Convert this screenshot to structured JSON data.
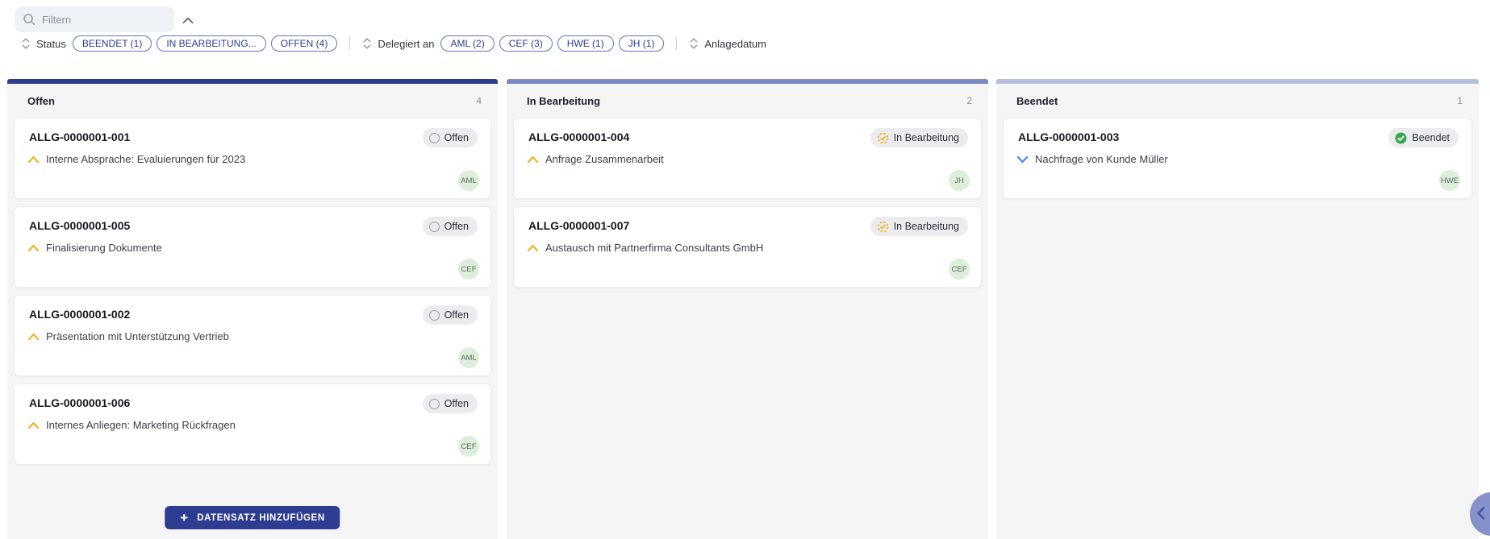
{
  "toolbar": {
    "search": {
      "placeholder": "Filtern"
    },
    "filters": [
      {
        "label": "Status",
        "pills": [
          "BEENDET (1)",
          "IN BEARBEITUNG...",
          "OFFEN (4)"
        ]
      },
      {
        "label": "Delegiert an",
        "pills": [
          "AML (2)",
          "CEF (3)",
          "HWE (1)",
          "JH (1)"
        ]
      },
      {
        "label": "Anlagedatum",
        "pills": []
      }
    ]
  },
  "board": {
    "columns": [
      {
        "title": "Offen",
        "count": "4",
        "accent": "#2e3c8c",
        "add_button": "DATENSATZ HINZUFÜGEN",
        "cards": [
          {
            "id": "ALLG-0000001-001",
            "description": "Interne Absprache: Evaluierungen für 2023",
            "status": "Offen",
            "status_type": "open",
            "priority": "up",
            "assignee": "AML"
          },
          {
            "id": "ALLG-0000001-005",
            "description": "Finalisierung Dokumente",
            "status": "Offen",
            "status_type": "open",
            "priority": "up",
            "assignee": "CEF"
          },
          {
            "id": "ALLG-0000001-002",
            "description": "Präsentation mit Unterstützung Vertrieb",
            "status": "Offen",
            "status_type": "open",
            "priority": "up",
            "assignee": "AML"
          },
          {
            "id": "ALLG-0000001-006",
            "description": "Internes Anliegen: Marketing Rückfragen",
            "status": "Offen",
            "status_type": "open",
            "priority": "up",
            "assignee": "CEF"
          }
        ]
      },
      {
        "title": "In Bearbeitung",
        "count": "2",
        "accent": "#7b89c2",
        "cards": [
          {
            "id": "ALLG-0000001-004",
            "description": "Anfrage Zusammenarbeit",
            "status": "In Bearbeitung",
            "status_type": "progress",
            "priority": "up",
            "assignee": "JH"
          },
          {
            "id": "ALLG-0000001-007",
            "description": "Austausch mit Partnerfirma Consultants GmbH",
            "status": "In Bearbeitung",
            "status_type": "progress",
            "priority": "up",
            "assignee": "CEF"
          }
        ]
      },
      {
        "title": "Beendet",
        "count": "1",
        "accent": "#b4bdda",
        "cards": [
          {
            "id": "ALLG-0000001-003",
            "description": "Nachfrage von Kunde Müller",
            "status": "Beendet",
            "status_type": "done",
            "priority": "down",
            "assignee": "HWE"
          }
        ]
      }
    ]
  },
  "colors": {
    "pill_border": "#6272bd",
    "pill_text": "#2d3d8f",
    "priority_up": "#f0b429",
    "priority_down": "#4f8ef7",
    "status_done": "#34a853",
    "status_progress": "#eeb117",
    "avatar_bg": "#ddeeda",
    "add_button_bg": "#2e3d92",
    "float_button_bg": "#8491ca"
  }
}
